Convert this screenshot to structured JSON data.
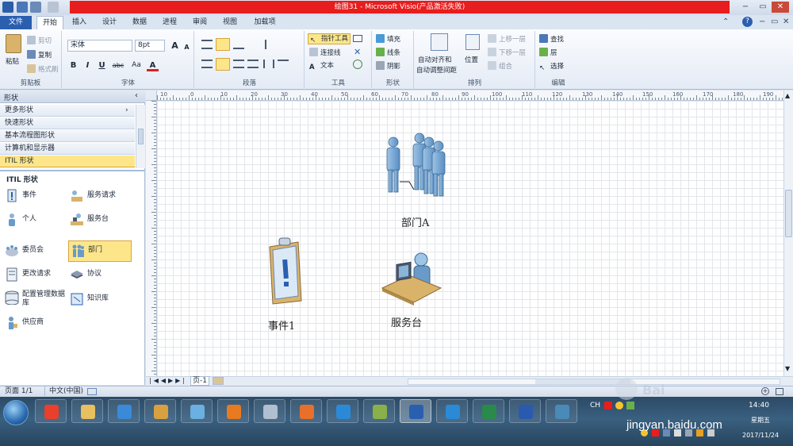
{
  "window": {
    "title": "绘图31 - Microsoft Visio(产品激活失败)",
    "controls": {
      "minimize": "−",
      "restore": "▭",
      "close": "✕"
    }
  },
  "tabs": [
    "文件",
    "开始",
    "插入",
    "设计",
    "数据",
    "进程",
    "审阅",
    "视图",
    "加载项"
  ],
  "ribbon": {
    "clipboard": {
      "label": "剪贴板",
      "paste": "粘贴",
      "cut": "剪切",
      "copy": "复制",
      "format_painter": "格式刷"
    },
    "font": {
      "label": "字体",
      "font_name": "宋体",
      "font_size": "8pt",
      "bold": "B",
      "italic": "I",
      "underline": "U",
      "strike": "abc",
      "case": "Aa",
      "color": "A",
      "grow": "A",
      "shrink": "A"
    },
    "paragraph": {
      "label": "段落"
    },
    "tools": {
      "label": "工具",
      "pointer": "指针工具",
      "connector": "连接线",
      "text": "文本"
    },
    "shape": {
      "label": "形状",
      "fill": "填充",
      "line": "线条",
      "shadow": "阴影"
    },
    "arrange": {
      "label": "排列",
      "auto_align": "自动对齐和",
      "auto_align2": "自动调整间距",
      "position": "位置",
      "bring_forward": "上移一层",
      "send_backward": "下移一层",
      "group": "组合"
    },
    "editing": {
      "label": "编辑",
      "find": "查找",
      "layers": "层",
      "select": "选择"
    }
  },
  "shapes_panel": {
    "header": "形状",
    "shelves": [
      "更多形状",
      "快速形状",
      "基本流程图形状",
      "计算机和显示器",
      "ITIL 形状"
    ],
    "stencil_title": "ITIL 形状",
    "items": [
      {
        "label": "事件",
        "icon": "event-icon"
      },
      {
        "label": "服务请求",
        "icon": "service-request-icon"
      },
      {
        "label": "个人",
        "icon": "person-icon"
      },
      {
        "label": "服务台",
        "icon": "service-desk-icon"
      },
      {
        "label": "委员会",
        "icon": "committee-icon"
      },
      {
        "label": "部门",
        "icon": "department-icon"
      },
      {
        "label": "更改请求",
        "icon": "change-request-icon"
      },
      {
        "label": "协议",
        "icon": "agreement-icon"
      },
      {
        "label": "配置管理数据库",
        "icon": "cmdb-icon"
      },
      {
        "label": "知识库",
        "icon": "knowledge-base-icon"
      },
      {
        "label": "供应商",
        "icon": "supplier-icon"
      }
    ],
    "selected_shape": "部门"
  },
  "ruler": {
    "ticks": [
      "10",
      "0",
      "10",
      "20",
      "30",
      "40",
      "50",
      "60",
      "70",
      "80",
      "90",
      "100",
      "110",
      "120",
      "130",
      "140",
      "150",
      "160",
      "170",
      "180",
      "190",
      "200",
      "210"
    ]
  },
  "canvas": {
    "shapes": [
      {
        "label": "部门A",
        "kind": "department"
      },
      {
        "label": "事件1",
        "kind": "event"
      },
      {
        "label": "服务台",
        "kind": "service-desk"
      }
    ]
  },
  "page_tabs": {
    "current": "页-1"
  },
  "status": {
    "page": "页面 1/1",
    "language": "中文(中国)"
  },
  "taskbar": {
    "apps": [
      "start-orb",
      "360-security",
      "file-explorer",
      "internet-explorer",
      "paint",
      "windows-tool",
      "screenshot-tool",
      "calculator",
      "firefox",
      "video-app",
      "photo-app",
      "visio",
      "pen-app",
      "excel",
      "word",
      "remote-app"
    ],
    "active_app": "visio",
    "tray": {
      "lang": "CH",
      "time": "14:40",
      "day": "星期五",
      "date": "2017/11/24"
    }
  },
  "watermark": "jingyan.baidu.com",
  "colors": {
    "accent": "#2a5fb0",
    "title_alert": "#e81d1d",
    "selected": "#fde68a"
  }
}
